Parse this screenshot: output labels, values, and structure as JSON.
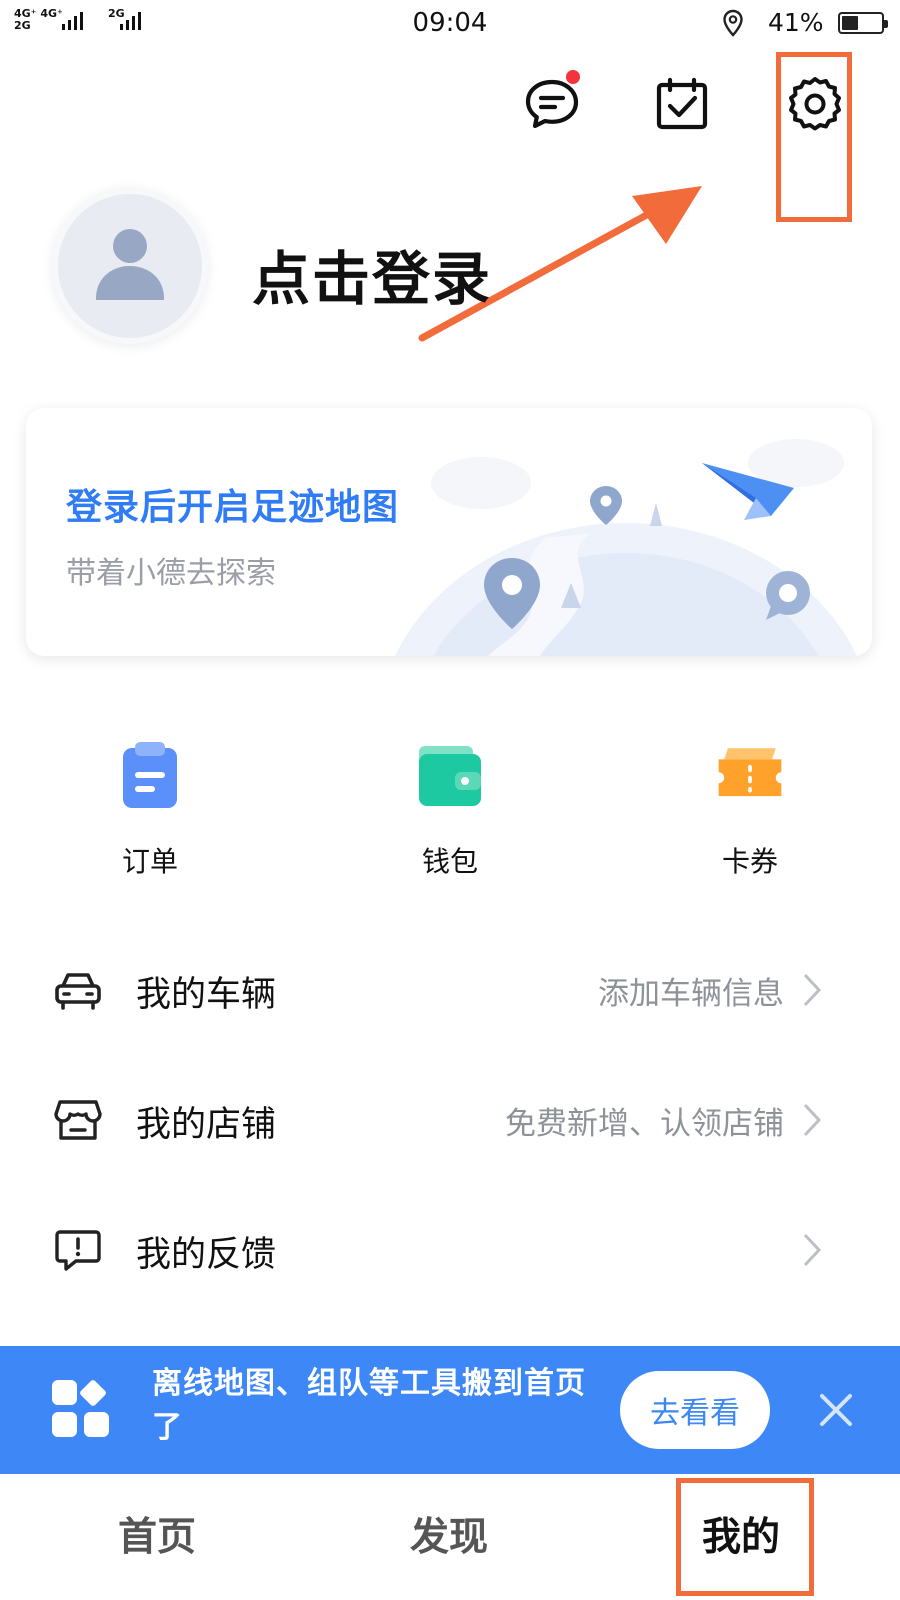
{
  "status_bar": {
    "signal_1": "4G⁺ 4G⁺\n2G",
    "signal_2": "2G",
    "time": "09:04",
    "battery_percent": "41%",
    "battery_level": 0.41
  },
  "header": {
    "message_has_badge": true,
    "icons": [
      "chat-bubble-icon",
      "calendar-check-icon",
      "gear-icon"
    ]
  },
  "profile": {
    "login_label": "点击登录"
  },
  "footprint_card": {
    "title": "登录后开启足迹地图",
    "subtitle": "带着小德去探索"
  },
  "quick_actions": [
    {
      "label": "订单",
      "icon": "clipboard-icon",
      "color": "#5b8ff9"
    },
    {
      "label": "钱包",
      "icon": "wallet-icon",
      "color": "#1cc9a0"
    },
    {
      "label": "卡券",
      "icon": "ticket-icon",
      "color": "#ffa22b"
    }
  ],
  "list": {
    "vehicle": {
      "label": "我的车辆",
      "value": "添加车辆信息"
    },
    "shop": {
      "label": "我的店铺",
      "value": "免费新增、认领店铺"
    },
    "feedback": {
      "label": "我的反馈",
      "value": ""
    }
  },
  "banner": {
    "text": "离线地图、组队等工具搬到首页了",
    "button": "去看看",
    "color": "#3d87f6"
  },
  "tabs": {
    "home": "首页",
    "discover": "发现",
    "mine": "我的"
  },
  "annotations": {
    "highlight_color": "#f26b3a"
  }
}
